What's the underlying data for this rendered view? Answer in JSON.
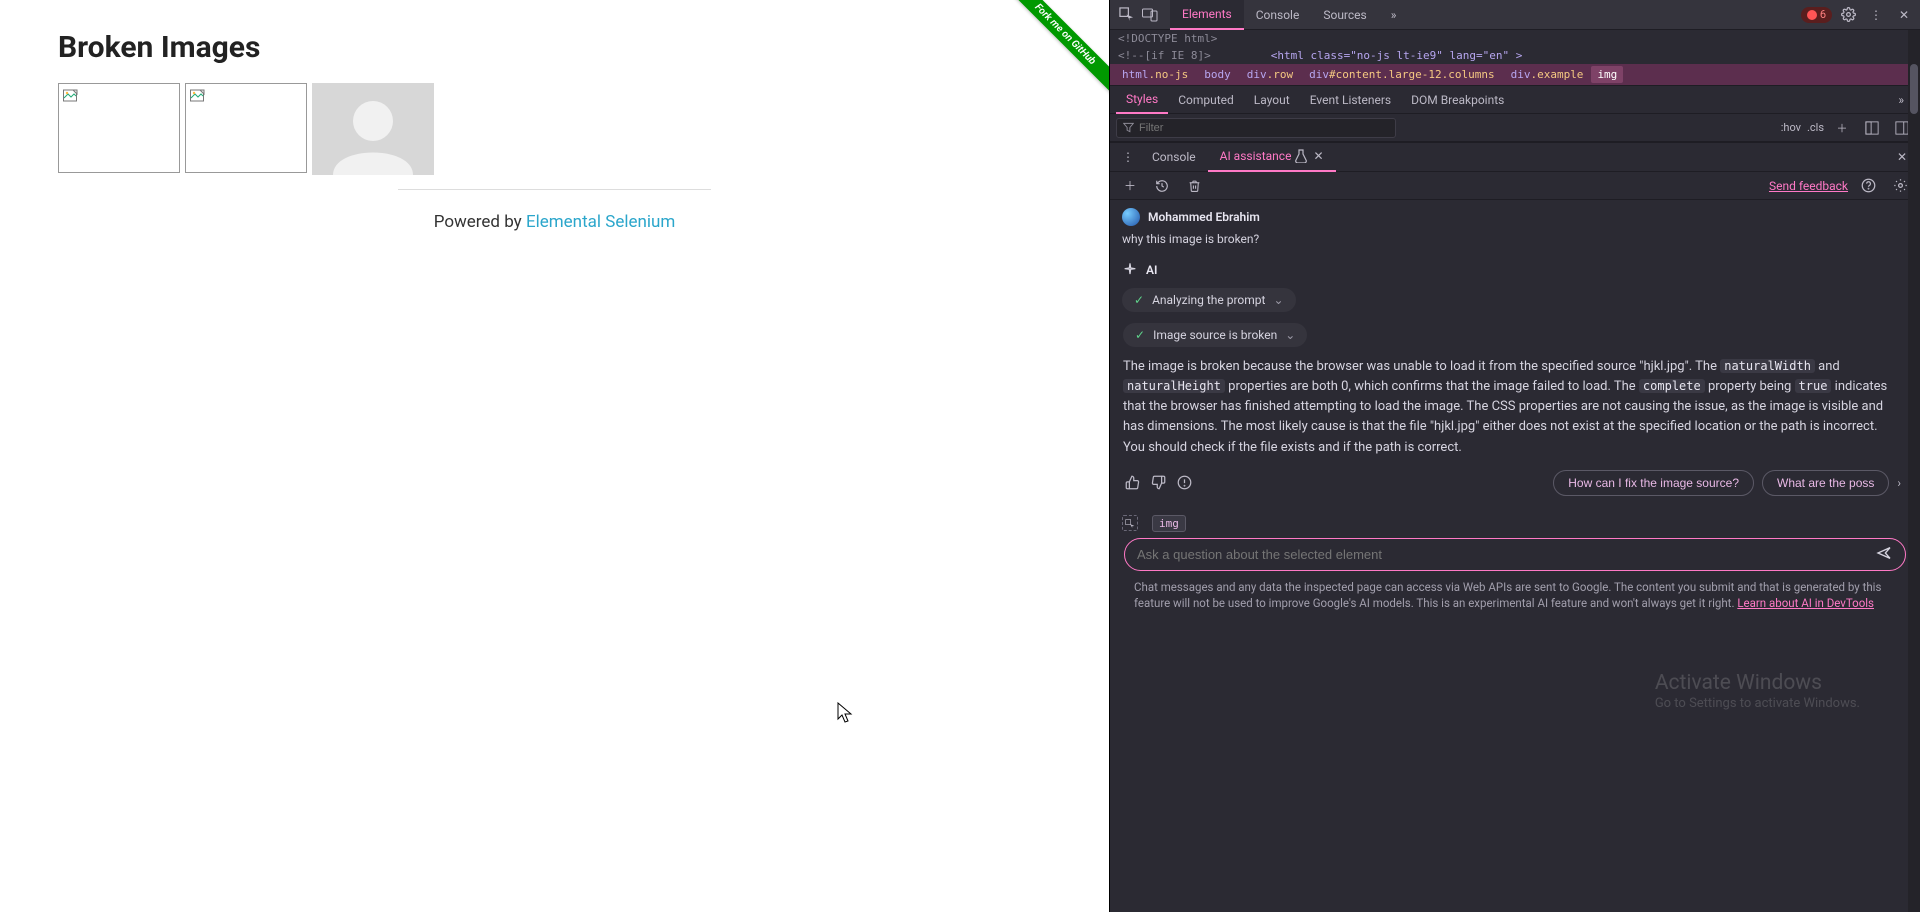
{
  "page": {
    "title": "Broken Images",
    "footer_prefix": "Powered by ",
    "footer_link": "Elemental Selenium",
    "fork_label": "Fork me on GitHub"
  },
  "devtools": {
    "tabs": {
      "elements": "Elements",
      "console": "Console",
      "sources": "Sources"
    },
    "error_count": "6",
    "dom_line1": "<!DOCTYPE html>",
    "dom_line2_a": "<!--[if IE 8]>",
    "dom_line2_b": "<html class=\"no-js lt-ie9\" lang=\"en\" >",
    "breadcrumbs": {
      "html": "html",
      "html_cls": ".no-js",
      "body": "body",
      "row": "div",
      "row_cls": ".row",
      "content": "div",
      "content_sel": "#content.large-12.columns",
      "example": "div",
      "example_cls": ".example",
      "img": "img"
    },
    "subtabs": {
      "styles": "Styles",
      "computed": "Computed",
      "layout": "Layout",
      "eventlisteners": "Event Listeners",
      "dombp": "DOM Breakpoints"
    },
    "filter_placeholder": "Filter",
    "hov": ":hov",
    "cls": ".cls",
    "drawer": {
      "console": "Console",
      "ai": "AI assistance"
    },
    "send_feedback": "Send feedback",
    "user_name": "Mohammed Ebrahim",
    "user_question": "why this image is broken?",
    "ai_label": "AI",
    "step1": "Analyzing the prompt",
    "step2": "Image source is broken",
    "response": {
      "p1a": "The image is broken because the browser was unable to load it from the specified source \"hjkl.jpg\". The ",
      "c1": "naturalWidth",
      "p1b": " and ",
      "c2": "naturalHeight",
      "p1c": " properties are both 0, which confirms that the image failed to load. The ",
      "c3": "complete",
      "p1d": " property being ",
      "c4": "true",
      "p1e": " indicates that the browser has finished attempting to load the image. The CSS properties are not causing the issue, as the image is visible and has dimensions. The most likely cause is that the file \"hjkl.jpg\" either does not exist at the specified location or the path is incorrect. You should check if the file exists and if the path is correct."
    },
    "suggest1": "How can I fix the image source?",
    "suggest2": "What are the poss",
    "element_chip": "img",
    "input_placeholder": "Ask a question about the selected element",
    "watermark_title": "Activate Windows",
    "watermark_sub": "Go to Settings to activate Windows.",
    "disclaimer": "Chat messages and any data the inspected page can access via Web APIs are sent to Google. The content you submit and that is generated by this feature will not be used to improve Google's AI models. This is an experimental AI feature and won't always get it right. ",
    "disclaimer_link": "Learn about AI in DevTools"
  }
}
